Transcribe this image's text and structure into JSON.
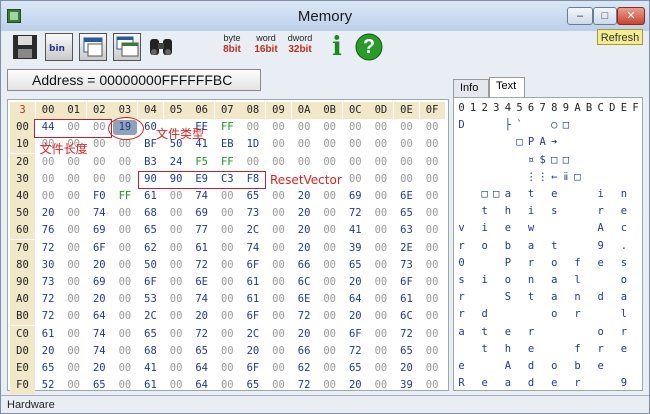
{
  "window": {
    "title": "Memory",
    "min_label": "–",
    "max_label": "□",
    "close_label": "✕"
  },
  "toolbar": {
    "byte_top": "byte",
    "byte_bottom": "8bit",
    "word_top": "word",
    "word_bottom": "16bit",
    "dword_top": "dword",
    "dword_bottom": "32bit",
    "info_label": "i",
    "help_label": "?",
    "refresh_label": "Refresh"
  },
  "address": {
    "text": "Address = 00000000FFFFFFBC"
  },
  "tabs": {
    "info": "Info",
    "text": "Text"
  },
  "hex": {
    "corner": "3",
    "columns": [
      "00",
      "01",
      "02",
      "03",
      "04",
      "05",
      "06",
      "07",
      "08",
      "09",
      "0A",
      "0B",
      "0C",
      "0D",
      "0E",
      "0F"
    ],
    "rows": [
      {
        "addr": "00",
        "bytes": [
          "44",
          "00",
          "00",
          "19",
          "60",
          "",
          "EE",
          "FF",
          "00",
          "00",
          "00",
          "00",
          "00",
          "00",
          "00",
          "00"
        ]
      },
      {
        "addr": "10",
        "bytes": [
          "00",
          "00",
          "00",
          "00",
          "BF",
          "50",
          "41",
          "EB",
          "1D",
          "00",
          "00",
          "00",
          "00",
          "00",
          "00",
          "00"
        ]
      },
      {
        "addr": "20",
        "bytes": [
          "00",
          "00",
          "00",
          "00",
          "B3",
          "24",
          "F5",
          "FF",
          "00",
          "00",
          "00",
          "00",
          "00",
          "00",
          "00",
          "00"
        ]
      },
      {
        "addr": "30",
        "bytes": [
          "00",
          "00",
          "00",
          "00",
          "90",
          "90",
          "E9",
          "C3",
          "F8",
          "",
          "",
          "",
          "00",
          "00",
          "00",
          "00"
        ]
      },
      {
        "addr": "40",
        "bytes": [
          "00",
          "00",
          "F0",
          "FF",
          "61",
          "00",
          "74",
          "00",
          "65",
          "00",
          "20",
          "00",
          "69",
          "00",
          "6E",
          "00"
        ]
      },
      {
        "addr": "50",
        "bytes": [
          "20",
          "00",
          "74",
          "00",
          "68",
          "00",
          "69",
          "00",
          "73",
          "00",
          "20",
          "00",
          "72",
          "00",
          "65",
          "00"
        ]
      },
      {
        "addr": "60",
        "bytes": [
          "76",
          "00",
          "69",
          "00",
          "65",
          "00",
          "77",
          "00",
          "2C",
          "00",
          "20",
          "00",
          "41",
          "00",
          "63",
          "00"
        ]
      },
      {
        "addr": "70",
        "bytes": [
          "72",
          "00",
          "6F",
          "00",
          "62",
          "00",
          "61",
          "00",
          "74",
          "00",
          "20",
          "00",
          "39",
          "00",
          "2E",
          "00"
        ]
      },
      {
        "addr": "80",
        "bytes": [
          "30",
          "00",
          "20",
          "00",
          "50",
          "00",
          "72",
          "00",
          "6F",
          "00",
          "66",
          "00",
          "65",
          "00",
          "73",
          "00"
        ]
      },
      {
        "addr": "90",
        "bytes": [
          "73",
          "00",
          "69",
          "00",
          "6F",
          "00",
          "6E",
          "00",
          "61",
          "00",
          "6C",
          "00",
          "20",
          "00",
          "6F",
          "00"
        ]
      },
      {
        "addr": "A0",
        "bytes": [
          "72",
          "00",
          "20",
          "00",
          "53",
          "00",
          "74",
          "00",
          "61",
          "00",
          "6E",
          "00",
          "64",
          "00",
          "61",
          "00"
        ]
      },
      {
        "addr": "B0",
        "bytes": [
          "72",
          "00",
          "64",
          "00",
          "2C",
          "00",
          "20",
          "00",
          "6F",
          "00",
          "72",
          "00",
          "20",
          "00",
          "6C",
          "00"
        ]
      },
      {
        "addr": "C0",
        "bytes": [
          "61",
          "00",
          "74",
          "00",
          "65",
          "00",
          "72",
          "00",
          "2C",
          "00",
          "20",
          "00",
          "6F",
          "00",
          "72",
          "00"
        ]
      },
      {
        "addr": "D0",
        "bytes": [
          "20",
          "00",
          "74",
          "00",
          "68",
          "00",
          "65",
          "00",
          "20",
          "00",
          "66",
          "00",
          "72",
          "00",
          "65",
          "00"
        ]
      },
      {
        "addr": "E0",
        "bytes": [
          "65",
          "00",
          "20",
          "00",
          "41",
          "00",
          "64",
          "00",
          "6F",
          "00",
          "62",
          "00",
          "65",
          "00",
          "20",
          "00"
        ]
      },
      {
        "addr": "F0",
        "bytes": [
          "52",
          "00",
          "65",
          "00",
          "61",
          "00",
          "64",
          "00",
          "65",
          "00",
          "72",
          "00",
          "20",
          "00",
          "39",
          "00"
        ]
      }
    ]
  },
  "text": {
    "columns": [
      "0",
      "1",
      "2",
      "3",
      "4",
      "5",
      "6",
      "7",
      "8",
      "9",
      "A",
      "B",
      "C",
      "D",
      "E",
      "F"
    ],
    "rows": [
      [
        "D",
        "",
        "",
        "",
        "├",
        "`",
        "",
        "",
        "○",
        "□",
        "",
        "",
        "",
        "",
        "",
        ""
      ],
      [
        "",
        "",
        "",
        "",
        "",
        "□",
        "P",
        "A",
        "➔",
        "",
        "",
        "",
        "",
        "",
        "",
        ""
      ],
      [
        "",
        "",
        "",
        "",
        "",
        "",
        "¤",
        "$",
        "□",
        "□",
        "",
        "",
        "",
        "",
        "",
        ""
      ],
      [
        "",
        "",
        "",
        "",
        "",
        "",
        "⋮",
        "⋮",
        "←",
        "ⅱ",
        "□",
        "",
        "",
        "",
        "",
        ""
      ],
      [
        "",
        "",
        "□",
        "□",
        "a",
        "",
        "t",
        "",
        "e",
        "",
        "",
        "",
        "i",
        "",
        "n",
        ""
      ],
      [
        "",
        "",
        "t",
        "",
        "h",
        "",
        "i",
        "",
        "s",
        "",
        "",
        "",
        "r",
        "",
        "e",
        ""
      ],
      [
        "v",
        "",
        "i",
        "",
        "e",
        "",
        "w",
        "",
        "",
        "",
        "",
        "",
        "A",
        "",
        "c",
        ""
      ],
      [
        "r",
        "",
        "o",
        "",
        "b",
        "",
        "a",
        "",
        "t",
        "",
        "",
        "",
        "9",
        "",
        ".",
        ""
      ],
      [
        "0",
        "",
        "",
        "",
        "P",
        "",
        "r",
        "",
        "o",
        "",
        "f",
        "",
        "e",
        "",
        "s",
        ""
      ],
      [
        "s",
        "",
        "i",
        "",
        "o",
        "",
        "n",
        "",
        "a",
        "",
        "l",
        "",
        "",
        "",
        "o",
        ""
      ],
      [
        "r",
        "",
        "",
        "",
        "S",
        "",
        "t",
        "",
        "a",
        "",
        "n",
        "",
        "d",
        "",
        "a",
        ""
      ],
      [
        "r",
        "",
        "d",
        "",
        "",
        "",
        "",
        "",
        "o",
        "",
        "r",
        "",
        "",
        "",
        "l",
        ""
      ],
      [
        "a",
        "",
        "t",
        "",
        "e",
        "",
        "r",
        "",
        "",
        "",
        "",
        "",
        "o",
        "",
        "r",
        ""
      ],
      [
        "",
        "",
        "t",
        "",
        "h",
        "",
        "e",
        "",
        "",
        "",
        "f",
        "",
        "r",
        "",
        "e",
        ""
      ],
      [
        "e",
        "",
        "",
        "",
        "A",
        "",
        "d",
        "",
        "o",
        "",
        "b",
        "",
        "e",
        "",
        "",
        ""
      ],
      [
        "R",
        "",
        "e",
        "",
        "a",
        "",
        "d",
        "",
        "e",
        "",
        "r",
        "",
        "",
        "",
        "9",
        ""
      ]
    ]
  },
  "annotations": {
    "file_length": "文件长度",
    "file_type": "文件类型",
    "reset_vector": "ResetVector"
  },
  "status": {
    "text": "Hardware"
  }
}
